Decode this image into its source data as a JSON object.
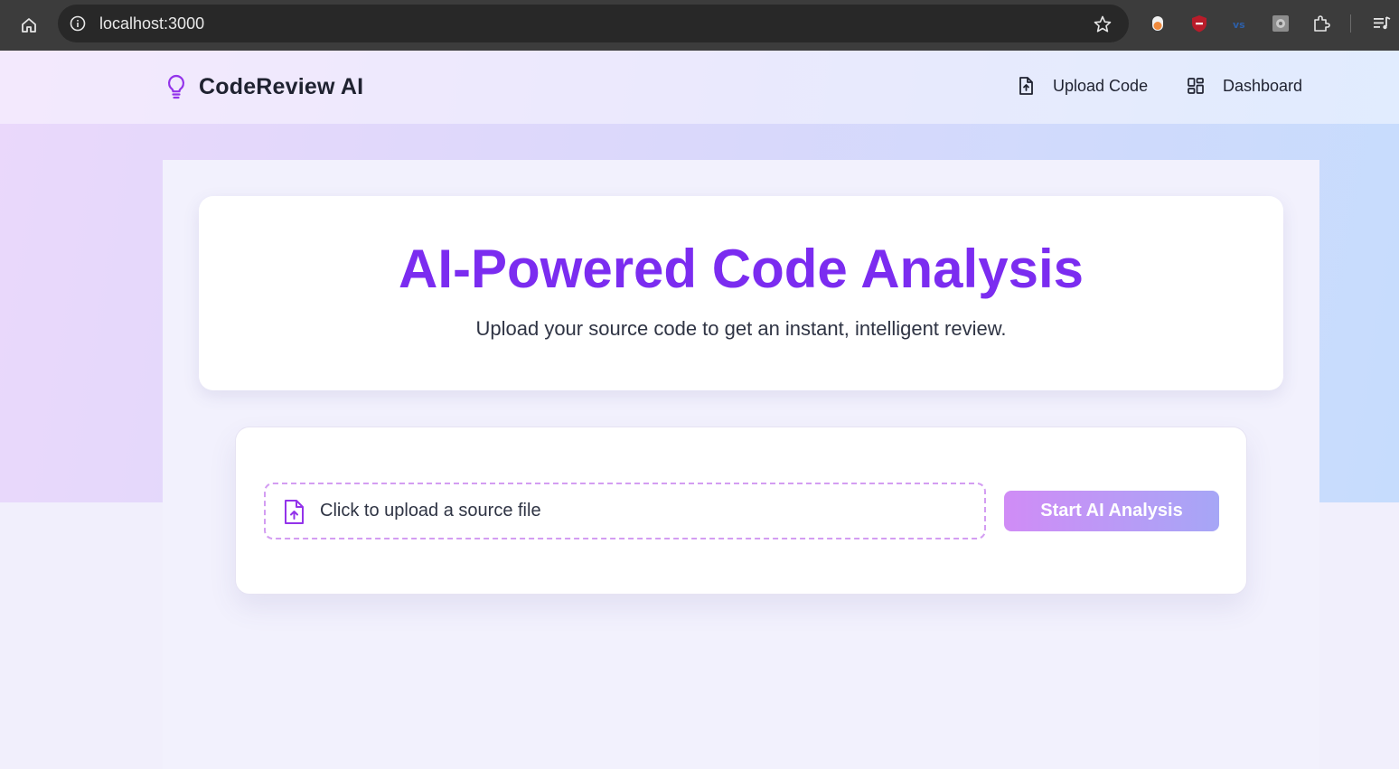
{
  "browser": {
    "url": "localhost:3000",
    "icons": [
      "home-icon",
      "info-icon",
      "star-icon",
      "extension-icons",
      "puzzle-icon",
      "media-icon"
    ]
  },
  "nav": {
    "brand": "CodeReview AI",
    "brand_icon": "lightbulb-icon",
    "links": [
      {
        "label": "Upload Code",
        "icon": "file-upload-icon"
      },
      {
        "label": "Dashboard",
        "icon": "grid-icon"
      }
    ]
  },
  "hero": {
    "title": "AI-Powered Code Analysis",
    "subtitle": "Upload your source code to get an instant, intelligent review."
  },
  "upload": {
    "dropzone_text": "Click to upload a source file",
    "button_label": "Start AI Analysis"
  },
  "colors": {
    "accent": "#7b2cf0",
    "dropzone_border": "#d39df2",
    "button_gradient_start": "#d08cf6",
    "button_gradient_end": "#a6a6f6"
  }
}
